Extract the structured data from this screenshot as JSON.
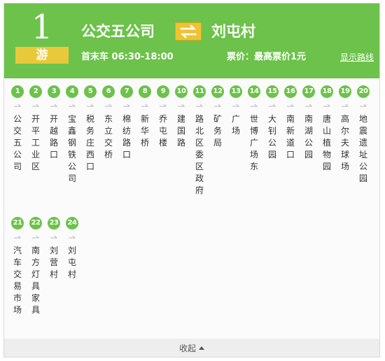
{
  "route": {
    "number": "1",
    "tag": "游",
    "from": "公交五公司",
    "to": "刘屯村",
    "hours_label": "首末车 06:30-18:00",
    "price_label": "票价：最高票价1元",
    "show_line_link": "显示路线"
  },
  "stops": [
    {
      "num": "1",
      "name": "公交五公司"
    },
    {
      "num": "2",
      "name": "开平工业区"
    },
    {
      "num": "3",
      "name": "开越路口"
    },
    {
      "num": "4",
      "name": "宝鑫钢铁公司"
    },
    {
      "num": "5",
      "name": "税务庄西口"
    },
    {
      "num": "6",
      "name": "东立交桥"
    },
    {
      "num": "7",
      "name": "棉纺路口"
    },
    {
      "num": "8",
      "name": "新华桥"
    },
    {
      "num": "9",
      "name": "乔屯楼"
    },
    {
      "num": "10",
      "name": "建国路"
    },
    {
      "num": "11",
      "name": "路北区委区政府"
    },
    {
      "num": "12",
      "name": "矿务局"
    },
    {
      "num": "13",
      "name": "广场"
    },
    {
      "num": "14",
      "name": "世博广场东"
    },
    {
      "num": "15",
      "name": "大钊公园"
    },
    {
      "num": "16",
      "name": "南新道口"
    },
    {
      "num": "17",
      "name": "南湖公园"
    },
    {
      "num": "18",
      "name": "唐山植物园"
    },
    {
      "num": "19",
      "name": "高尔夫球场"
    },
    {
      "num": "20",
      "name": "地震遗址公园"
    },
    {
      "num": "21",
      "name": "汽车交易市场"
    },
    {
      "num": "22",
      "name": "南方灯具家具"
    },
    {
      "num": "23",
      "name": "刘营村"
    },
    {
      "num": "24",
      "name": "刘屯村"
    }
  ],
  "footer": {
    "collapse_label": "收起"
  },
  "colors": {
    "brand_green": "#6cc24a",
    "tag_yellow": "#e8c93a",
    "swap_yellow": "#f0c330"
  }
}
